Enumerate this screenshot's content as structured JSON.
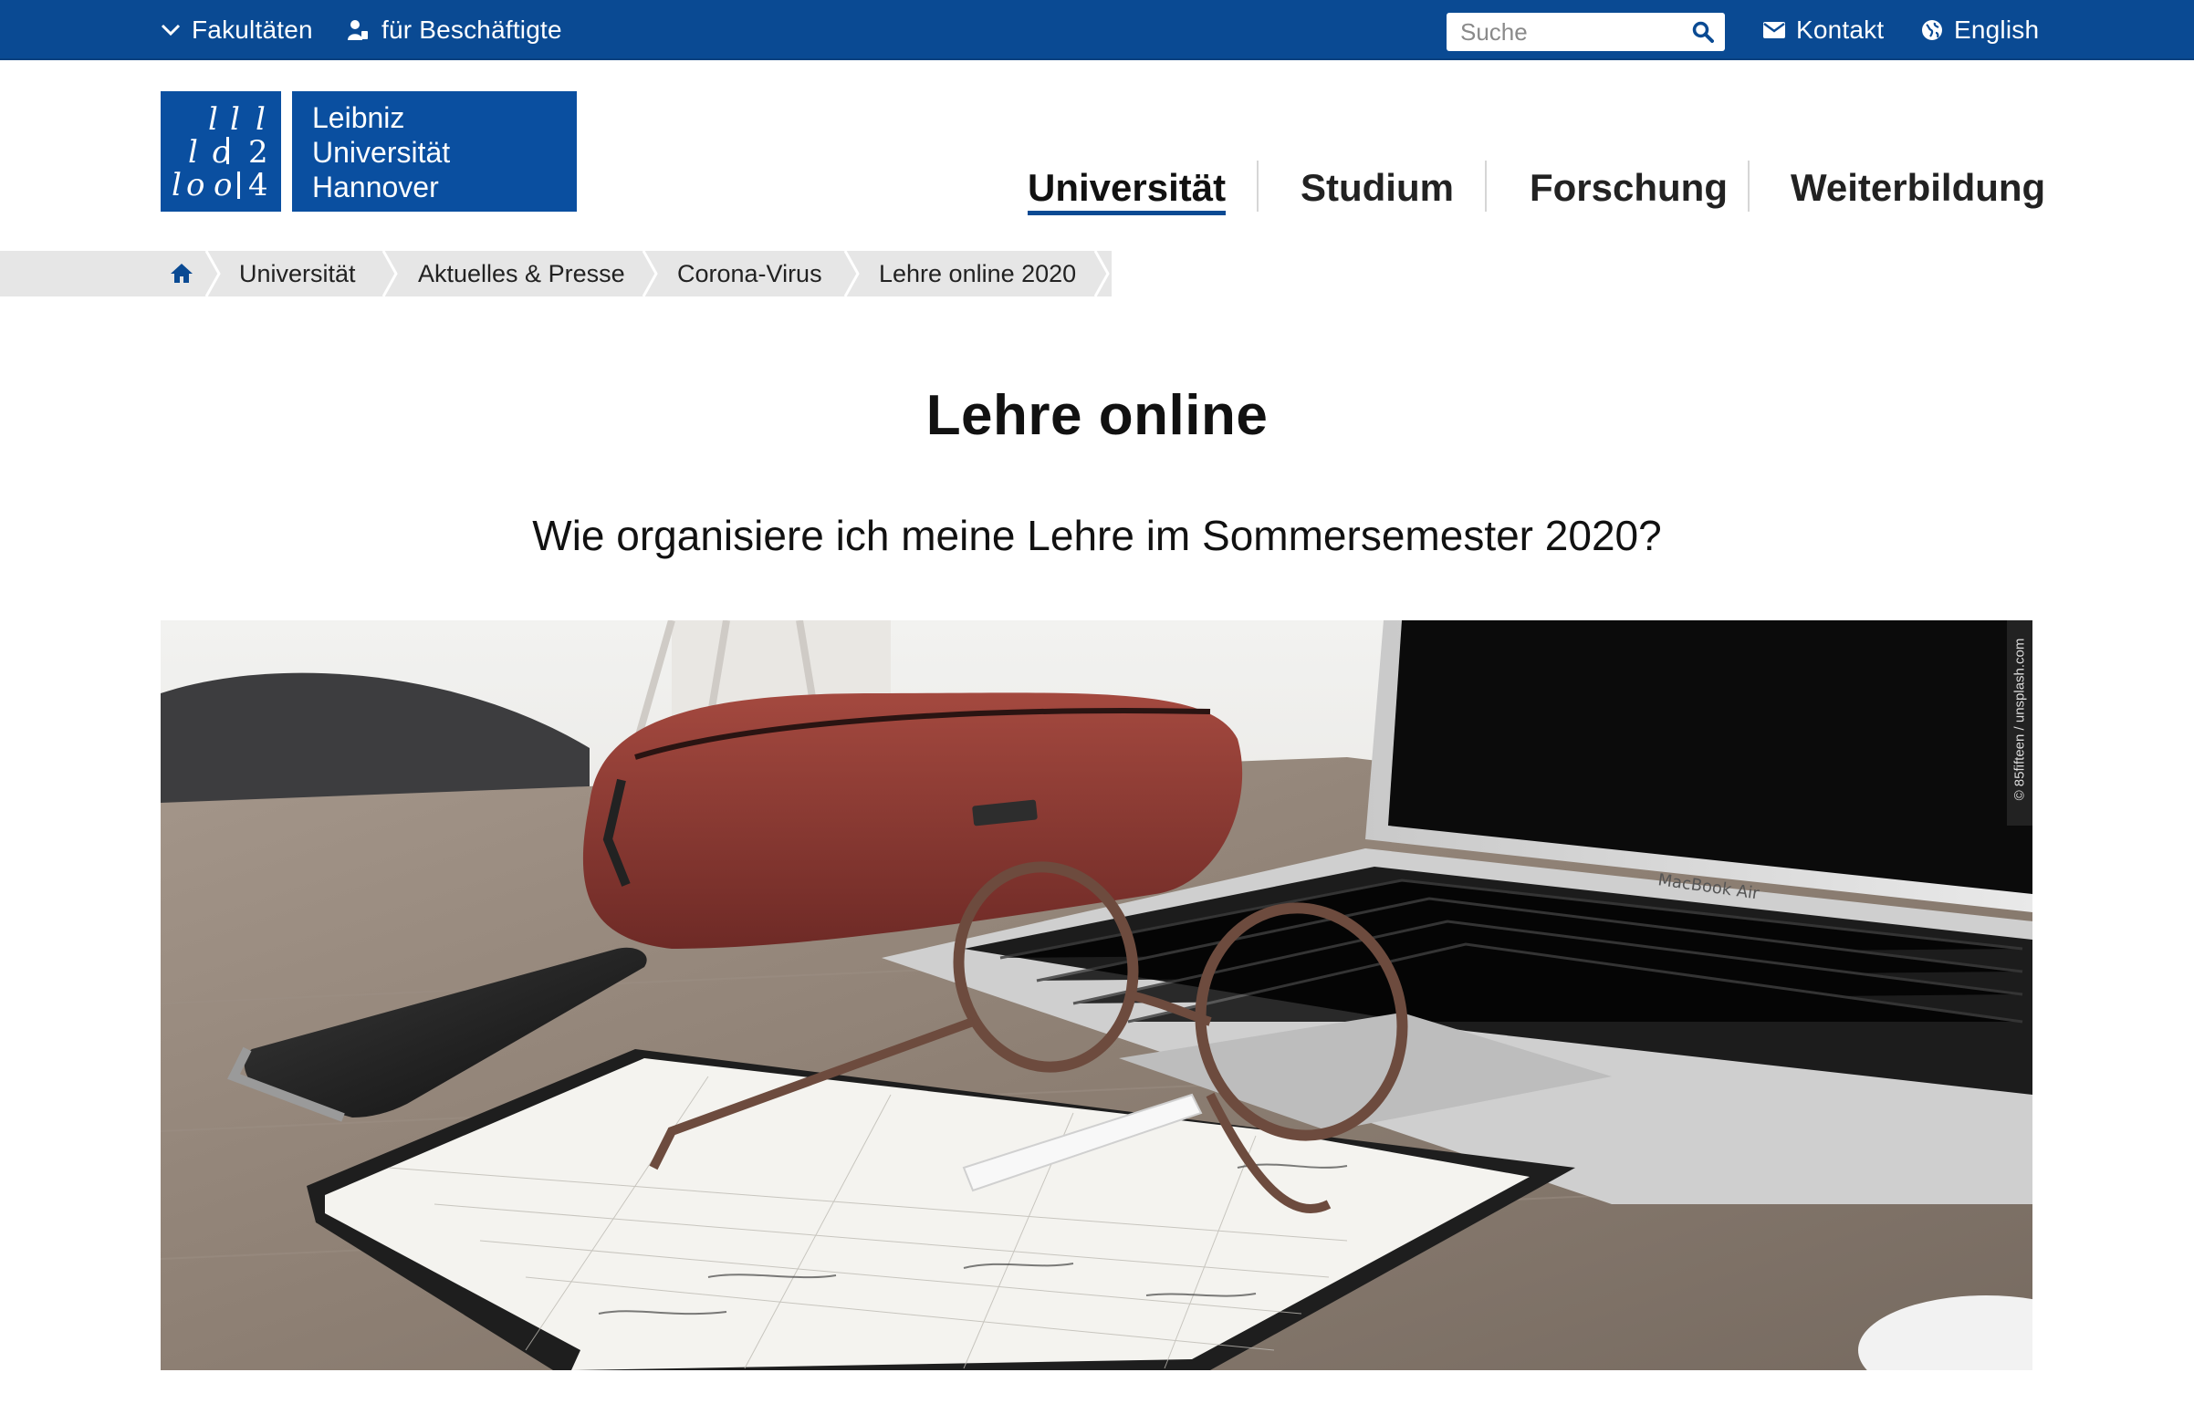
{
  "topbar": {
    "faculties_label": "Fakultäten",
    "staff_label": "für Beschäftigte",
    "search_placeholder": "Suche",
    "contact_label": "Kontakt",
    "language_label": "English",
    "background_color": "#0a4a93"
  },
  "logo": {
    "mark_text": "1 1 1  1 0 2  1 0 0 4",
    "line1": "Leibniz",
    "line2": "Universität",
    "line3": "Hannover",
    "color": "#0a4fa0"
  },
  "mainnav": {
    "items": [
      {
        "label": "Universität",
        "active": true
      },
      {
        "label": "Studium",
        "active": false
      },
      {
        "label": "Forschung",
        "active": false
      },
      {
        "label": "Weiterbildung",
        "active": false
      }
    ]
  },
  "breadcrumb": {
    "home_icon": "home-icon",
    "items": [
      "Universität",
      "Aktuelles & Presse",
      "Corona-Virus",
      "Lehre online 2020"
    ]
  },
  "content": {
    "title": "Lehre online",
    "subtitle": "Wie organisiere ich meine Lehre im Sommersemester 2020?",
    "image_credit": "© 85fifteen / unsplash.com"
  }
}
